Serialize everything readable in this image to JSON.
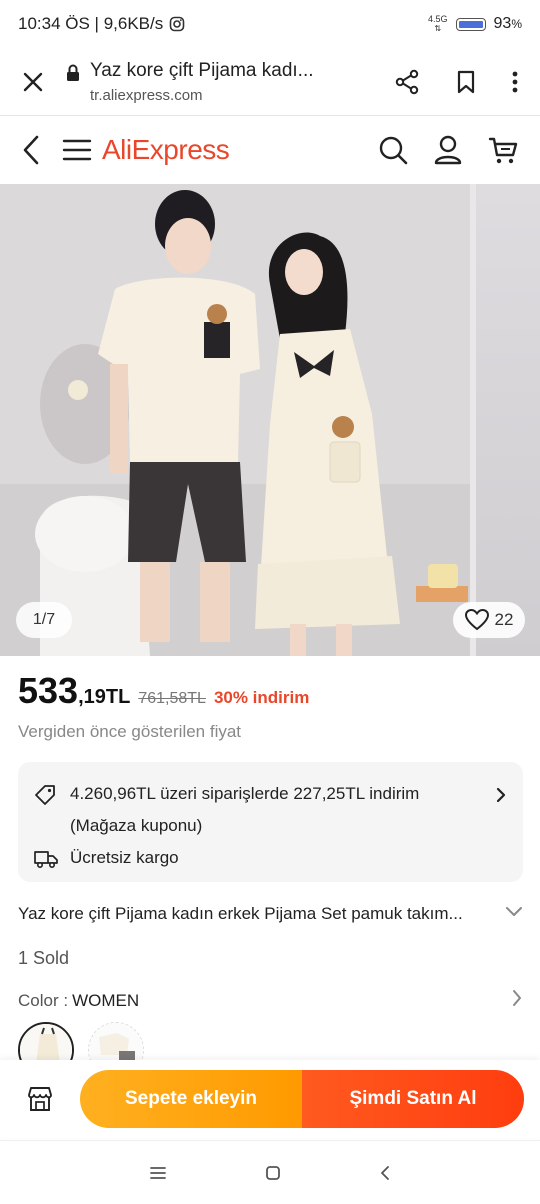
{
  "status": {
    "time_speed": "10:34 ÖS | 9,6KB/s",
    "network": "4.5G",
    "battery": "93",
    "battery_unit": "%"
  },
  "browser": {
    "page_title": "Yaz kore çift Pijama kadı...",
    "url": "tr.aliexpress.com"
  },
  "site": {
    "logo": "AliExpress"
  },
  "gallery": {
    "counter": "1/7",
    "likes": "22"
  },
  "price": {
    "int": "533",
    "dec": ",19",
    "currency": "TL",
    "old": "761,58TL",
    "discount": "30% indirim",
    "tax_note": "Vergiden önce gösterilen fiyat"
  },
  "coupon": {
    "line1": "4.260,96TL üzeri siparişlerde 227,25TL indirim",
    "line2": "(Mağaza kuponu)",
    "shipping": "Ücretsiz kargo"
  },
  "product": {
    "title": "Yaz kore çift Pijama kadın erkek Pijama Set pamuk takım...",
    "sold": "1 Sold",
    "color_label": "Color : ",
    "color_value": "WOMEN"
  },
  "actions": {
    "add_to_cart": "Sepete ekleyin",
    "buy_now": "Şimdi Satın Al"
  },
  "colors": {
    "brand": "#e8472b",
    "cart_btn": "#ffa010",
    "buy_btn": "#ff4a16"
  }
}
